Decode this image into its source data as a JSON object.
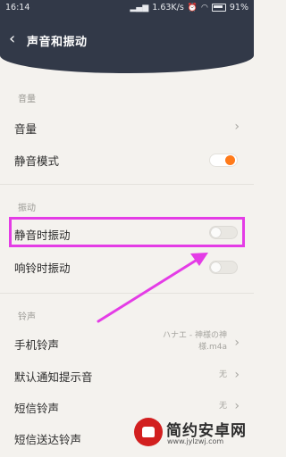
{
  "status_bar": {
    "time": "16:14",
    "network_speed": "1.63K/s",
    "battery": "91%",
    "icons": [
      "alarm-icon",
      "wifi-icon",
      "signal-icon",
      "battery-icon"
    ]
  },
  "header": {
    "title": "声音和振动",
    "back_icon": "chevron-left-icon",
    "background_color": "#323948"
  },
  "sections": {
    "volume": "音量",
    "vibration": "振动",
    "ringtone": "铃声"
  },
  "items": {
    "volume": {
      "label": "音量"
    },
    "silent_mode": {
      "label": "静音模式",
      "enabled": true
    },
    "vibrate_silent": {
      "label": "静音时振动",
      "enabled": false
    },
    "vibrate_ring": {
      "label": "响铃时振动",
      "enabled": false
    },
    "phone_ringtone": {
      "label": "手机铃声",
      "value_line1": "ハナエ - 神様の神",
      "value_line2": "様.m4a"
    },
    "notification_tone": {
      "label": "默认通知提示音",
      "value": "无"
    },
    "sms_tone": {
      "label": "短信铃声",
      "value": "无"
    },
    "sms_delivered_tone": {
      "label": "短信送达铃声"
    }
  },
  "colors": {
    "accent_toggle": "#ff7a1a",
    "highlight": "#e43ce6"
  },
  "watermark": {
    "title": "简约安卓网",
    "url": "www.jylzwj.com"
  }
}
